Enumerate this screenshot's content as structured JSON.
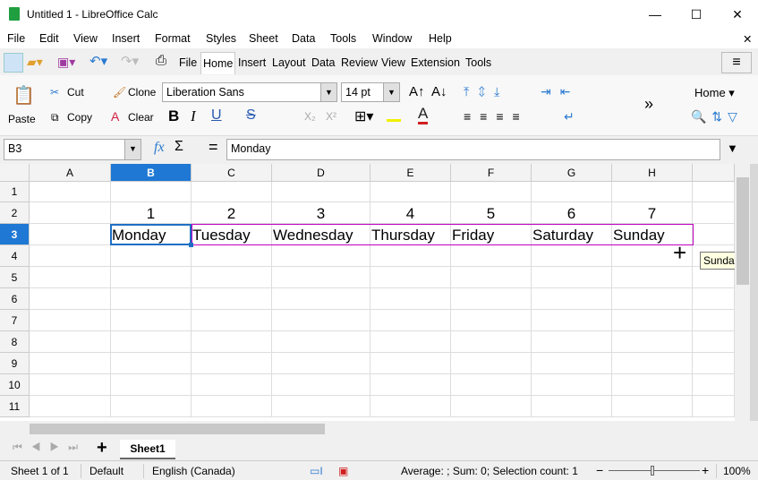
{
  "window": {
    "title": "Untitled 1 - LibreOffice Calc",
    "min": "—",
    "max": "☐",
    "close": "✕"
  },
  "menu": [
    "File",
    "Edit",
    "View",
    "Insert",
    "Format",
    "Styles",
    "Sheet",
    "Data",
    "Tools",
    "Window",
    "Help"
  ],
  "menu_close": "✕",
  "tabs": [
    "File",
    "Home",
    "Insert",
    "Layout",
    "Data",
    "Review",
    "View",
    "Extension",
    "Tools"
  ],
  "active_tab": "Home",
  "ribbon": {
    "paste": "Paste",
    "cut": "Cut",
    "copy": "Copy",
    "clone": "Clone",
    "clear": "Clear",
    "font": "Liberation Sans",
    "size": "14 pt",
    "bold": "B",
    "italic": "I",
    "underline": "U",
    "strike": "S",
    "sub": "X₂",
    "sup": "X²",
    "more": "»",
    "home_dropdown": "Home"
  },
  "formula": {
    "namebox": "B3",
    "fx": "fx",
    "sigma": "Σ",
    "equals": "=",
    "content": "Monday"
  },
  "columns": [
    "A",
    "B",
    "C",
    "D",
    "E",
    "F",
    "G",
    "H"
  ],
  "rows": [
    "1",
    "2",
    "3",
    "4",
    "5",
    "6",
    "7",
    "8",
    "9",
    "10",
    "11"
  ],
  "row2": [
    "",
    "1",
    "2",
    "3",
    "4",
    "5",
    "6",
    "7"
  ],
  "row3": [
    "",
    "Monday",
    "Tuesday",
    "Wednesday",
    "Thursday",
    "Friday",
    "Saturday",
    "Sunday"
  ],
  "tooltip": "Sunday",
  "sheet_tab": "Sheet1",
  "add_sheet": "+",
  "status": {
    "sheet": "Sheet 1 of 1",
    "style": "Default",
    "lang": "English (Canada)",
    "summary": "Average: ; Sum: 0; Selection count: 1",
    "zoom": "100%"
  },
  "colors": {
    "selection": "#1e6fc4",
    "autofill_border": "#c000c0",
    "active_header": "#1e78d4"
  }
}
